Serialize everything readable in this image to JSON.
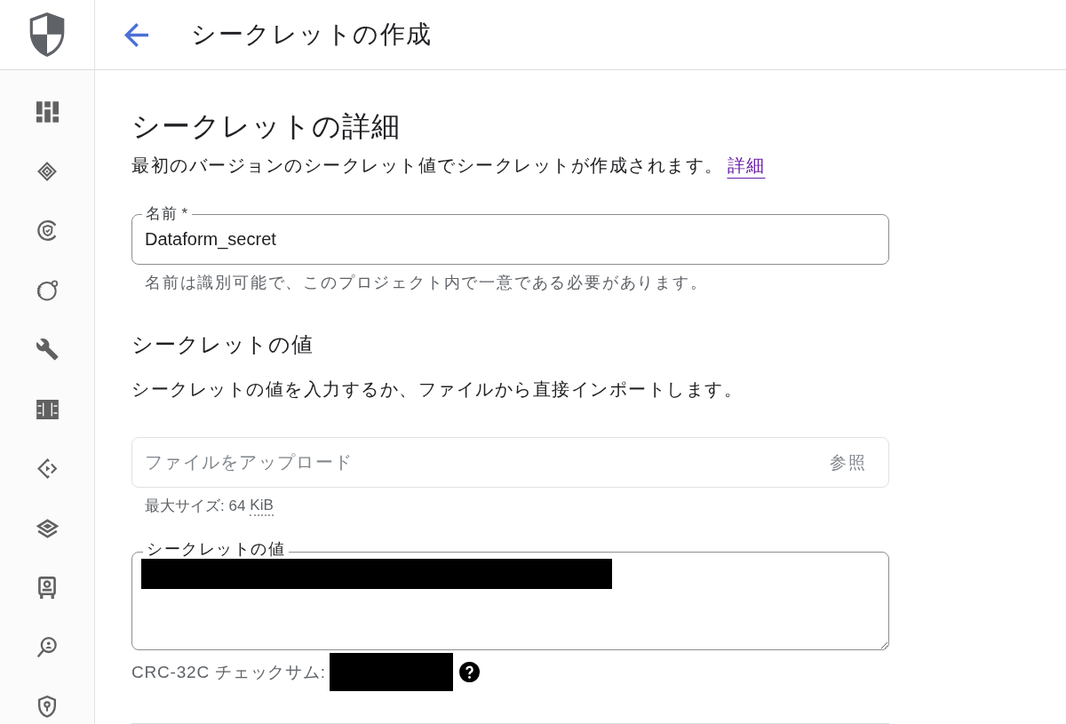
{
  "header": {
    "title": "シークレットの作成"
  },
  "details": {
    "heading": "シークレットの詳細",
    "description": "最初のバージョンのシークレット値でシークレットが作成されます。",
    "link": "詳細"
  },
  "name_field": {
    "label": "名前 *",
    "value": "Dataform_secret",
    "helper": "名前は識別可能で、このプロジェクト内で一意である必要があります。"
  },
  "value_section": {
    "heading": "シークレットの値",
    "description": "シークレットの値を入力するか、ファイルから直接インポートします。"
  },
  "upload_field": {
    "placeholder": "ファイルをアップロード",
    "button": "参照",
    "size_limit": "最大サイズ: 64",
    "size_unit": "KiB"
  },
  "secret_field": {
    "label": "シークレットの値"
  },
  "checksum": {
    "label": "CRC-32C チェックサム:"
  }
}
